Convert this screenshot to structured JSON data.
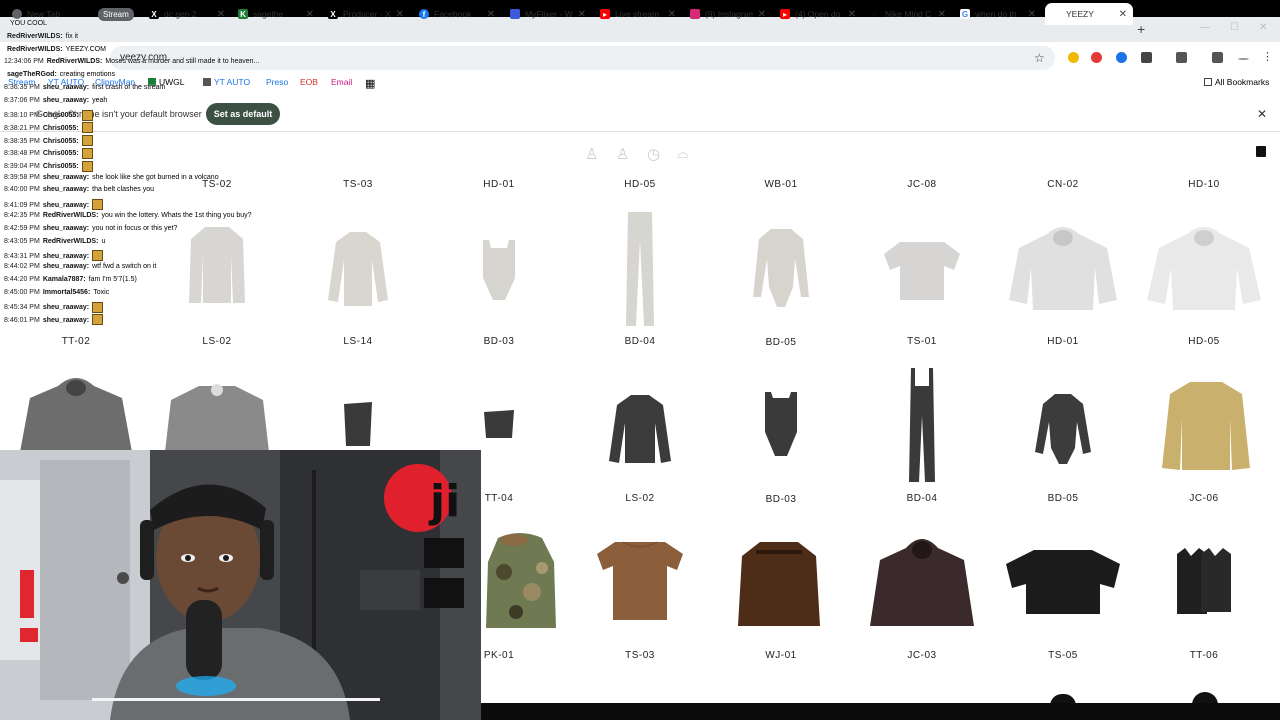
{
  "browser": {
    "tabs": [
      {
        "title": "New Tab",
        "icon": "chrome-icon",
        "color": "#5f6368"
      },
      {
        "title": "Stream",
        "icon": "tab-group-badge",
        "color": "#5f6368"
      },
      {
        "title": "dc gen 2",
        "icon": "x-icon",
        "color": "#000000"
      },
      {
        "title": "sagethe",
        "icon": "sage-icon",
        "color": "#1a7f37"
      },
      {
        "title": "Producer - X",
        "icon": "x-icon",
        "color": "#000000"
      },
      {
        "title": "Facebook",
        "icon": "facebook-icon",
        "color": "#1877f2"
      },
      {
        "title": "MyFlixer - W",
        "icon": "myflixer-icon",
        "color": "#3b5bdb"
      },
      {
        "title": "Live stream",
        "icon": "youtube-icon",
        "color": "#ff0000"
      },
      {
        "title": "(9) Instagram",
        "icon": "instagram-icon",
        "color": "#d62976"
      },
      {
        "title": "(4) Open do",
        "icon": "youtube-icon",
        "color": "#ff0000"
      },
      {
        "title": "Nike Mind C",
        "icon": "nike-icon",
        "color": "#111111"
      },
      {
        "title": "when do th",
        "icon": "google-icon",
        "color": "#4285f4"
      },
      {
        "title": "YEEZY",
        "icon": "blank-icon",
        "color": "#ffffff"
      }
    ],
    "url": "yeezy.com",
    "bookmarks": [
      {
        "label": "Stream",
        "color": "#1a73e8"
      },
      {
        "label": "YT AUTO",
        "color": "#1a73e8"
      },
      {
        "label": "ClippyMan",
        "color": "#1a73e8"
      },
      {
        "label": "UWGL",
        "color": "#333333"
      },
      {
        "label": "YT AUTO",
        "color": "#1a73e8"
      },
      {
        "label": "Preso",
        "color": "#1a73e8"
      },
      {
        "label": "EOB",
        "color": "#d93025"
      },
      {
        "label": "Email",
        "color": "#d01884"
      }
    ],
    "all_bookmarks": "All Bookmarks",
    "infobar_msg": "Google Chrome isn't your default browser",
    "set_default": "Set as default"
  },
  "products": {
    "row1": [
      "TS-02",
      "TS-03",
      "HD-01",
      "HD-05",
      "WB-01",
      "JC-08",
      "CN-02",
      "HD-10"
    ],
    "row2": [
      "TT-02",
      "LS-02",
      "LS-14",
      "BD-03",
      "BD-04",
      "BD-05",
      "TS-01",
      "HD-01",
      "HD-05"
    ],
    "row3": [
      "TT-04",
      "LS-02",
      "BD-03",
      "BD-04",
      "BD-05",
      "JC-06"
    ],
    "row4": [
      "PK-01",
      "TS-03",
      "WJ-01",
      "JC-03",
      "TS-05",
      "TT-06"
    ]
  },
  "chat": [
    {
      "ts": "",
      "user": "",
      "text": "YOU COOL"
    },
    {
      "ts": "",
      "user": "RedRiverWILDS:",
      "text": "fix it"
    },
    {
      "ts": "",
      "user": "RedRiverWILDS:",
      "text": "YEEZY.COM"
    },
    {
      "ts": "12:34:06 PM",
      "user": "RedRiverWILDS:",
      "text": "Moses was a murder and still made it to heaven..."
    },
    {
      "ts": "",
      "user": "sageTheRGod:",
      "text": "creating emotions"
    },
    {
      "ts": "8:36:35 PM",
      "user": "sheu_raaway:",
      "text": "first crash of the stream"
    },
    {
      "ts": "8:37:06 PM",
      "user": "sheu_raaway:",
      "text": "yeah"
    },
    {
      "ts": "8:38:10 PM",
      "user": "Chris0055:",
      "text": ""
    },
    {
      "ts": "8:38:21 PM",
      "user": "Chris0055:",
      "text": ""
    },
    {
      "ts": "8:38:35 PM",
      "user": "Chris0055:",
      "text": ""
    },
    {
      "ts": "8:38:48 PM",
      "user": "Chris0055:",
      "text": ""
    },
    {
      "ts": "8:39:04 PM",
      "user": "Chris0055:",
      "text": ""
    },
    {
      "ts": "8:39:58 PM",
      "user": "sheu_raaway:",
      "text": "she look like she got burned in a volcano"
    },
    {
      "ts": "8:40:00 PM",
      "user": "sheu_raaway:",
      "text": "tha belt clashes you"
    },
    {
      "ts": "8:41:09 PM",
      "user": "sheu_raaway:",
      "text": ""
    },
    {
      "ts": "8:42:35 PM",
      "user": "RedRiverWILDS:",
      "text": "you win the lottery. Whats the 1st thing you buy?"
    },
    {
      "ts": "8:42:59 PM",
      "user": "sheu_raaway:",
      "text": "you not in focus or this yet?"
    },
    {
      "ts": "8:43:05 PM",
      "user": "RedRiverWILDS:",
      "text": "u"
    },
    {
      "ts": "8:43:31 PM",
      "user": "sheu_raaway:",
      "text": ""
    },
    {
      "ts": "8:44:02 PM",
      "user": "sheu_raaway:",
      "text": "wtf fwd a switch on it"
    },
    {
      "ts": "8:44:20 PM",
      "user": "Kamala7887:",
      "text": "fam I'm 5'7(1.5)"
    },
    {
      "ts": "8:45:00 PM",
      "user": "Immortal5456:",
      "text": "Toxic"
    },
    {
      "ts": "8:45:34 PM",
      "user": "sheu_raaway:",
      "text": ""
    },
    {
      "ts": "8:46:01 PM",
      "user": "sheu_raaway:",
      "text": ""
    }
  ]
}
